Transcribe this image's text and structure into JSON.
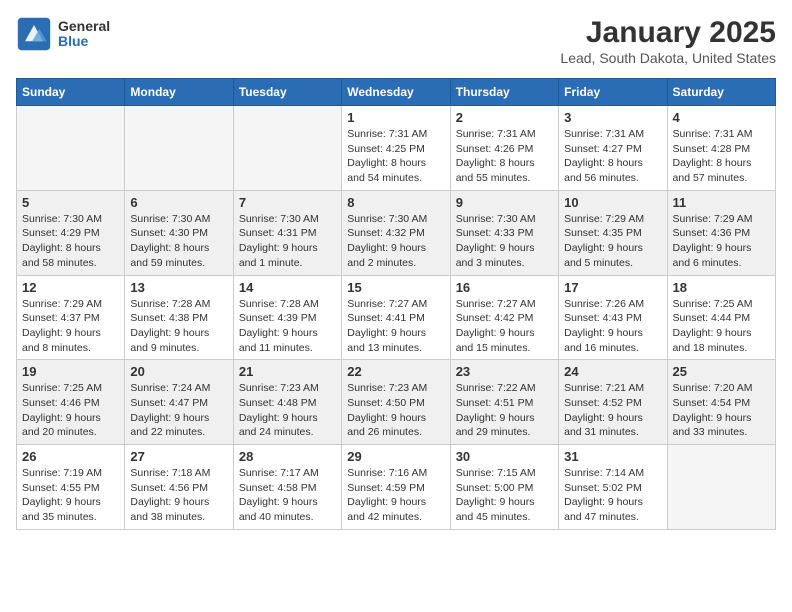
{
  "logo": {
    "general": "General",
    "blue": "Blue"
  },
  "title": {
    "month": "January 2025",
    "location": "Lead, South Dakota, United States"
  },
  "weekdays": [
    "Sunday",
    "Monday",
    "Tuesday",
    "Wednesday",
    "Thursday",
    "Friday",
    "Saturday"
  ],
  "weeks": [
    [
      {
        "day": "",
        "sunrise": "",
        "sunset": "",
        "daylight": ""
      },
      {
        "day": "",
        "sunrise": "",
        "sunset": "",
        "daylight": ""
      },
      {
        "day": "",
        "sunrise": "",
        "sunset": "",
        "daylight": ""
      },
      {
        "day": "1",
        "sunrise": "Sunrise: 7:31 AM",
        "sunset": "Sunset: 4:25 PM",
        "daylight": "Daylight: 8 hours and 54 minutes."
      },
      {
        "day": "2",
        "sunrise": "Sunrise: 7:31 AM",
        "sunset": "Sunset: 4:26 PM",
        "daylight": "Daylight: 8 hours and 55 minutes."
      },
      {
        "day": "3",
        "sunrise": "Sunrise: 7:31 AM",
        "sunset": "Sunset: 4:27 PM",
        "daylight": "Daylight: 8 hours and 56 minutes."
      },
      {
        "day": "4",
        "sunrise": "Sunrise: 7:31 AM",
        "sunset": "Sunset: 4:28 PM",
        "daylight": "Daylight: 8 hours and 57 minutes."
      }
    ],
    [
      {
        "day": "5",
        "sunrise": "Sunrise: 7:30 AM",
        "sunset": "Sunset: 4:29 PM",
        "daylight": "Daylight: 8 hours and 58 minutes."
      },
      {
        "day": "6",
        "sunrise": "Sunrise: 7:30 AM",
        "sunset": "Sunset: 4:30 PM",
        "daylight": "Daylight: 8 hours and 59 minutes."
      },
      {
        "day": "7",
        "sunrise": "Sunrise: 7:30 AM",
        "sunset": "Sunset: 4:31 PM",
        "daylight": "Daylight: 9 hours and 1 minute."
      },
      {
        "day": "8",
        "sunrise": "Sunrise: 7:30 AM",
        "sunset": "Sunset: 4:32 PM",
        "daylight": "Daylight: 9 hours and 2 minutes."
      },
      {
        "day": "9",
        "sunrise": "Sunrise: 7:30 AM",
        "sunset": "Sunset: 4:33 PM",
        "daylight": "Daylight: 9 hours and 3 minutes."
      },
      {
        "day": "10",
        "sunrise": "Sunrise: 7:29 AM",
        "sunset": "Sunset: 4:35 PM",
        "daylight": "Daylight: 9 hours and 5 minutes."
      },
      {
        "day": "11",
        "sunrise": "Sunrise: 7:29 AM",
        "sunset": "Sunset: 4:36 PM",
        "daylight": "Daylight: 9 hours and 6 minutes."
      }
    ],
    [
      {
        "day": "12",
        "sunrise": "Sunrise: 7:29 AM",
        "sunset": "Sunset: 4:37 PM",
        "daylight": "Daylight: 9 hours and 8 minutes."
      },
      {
        "day": "13",
        "sunrise": "Sunrise: 7:28 AM",
        "sunset": "Sunset: 4:38 PM",
        "daylight": "Daylight: 9 hours and 9 minutes."
      },
      {
        "day": "14",
        "sunrise": "Sunrise: 7:28 AM",
        "sunset": "Sunset: 4:39 PM",
        "daylight": "Daylight: 9 hours and 11 minutes."
      },
      {
        "day": "15",
        "sunrise": "Sunrise: 7:27 AM",
        "sunset": "Sunset: 4:41 PM",
        "daylight": "Daylight: 9 hours and 13 minutes."
      },
      {
        "day": "16",
        "sunrise": "Sunrise: 7:27 AM",
        "sunset": "Sunset: 4:42 PM",
        "daylight": "Daylight: 9 hours and 15 minutes."
      },
      {
        "day": "17",
        "sunrise": "Sunrise: 7:26 AM",
        "sunset": "Sunset: 4:43 PM",
        "daylight": "Daylight: 9 hours and 16 minutes."
      },
      {
        "day": "18",
        "sunrise": "Sunrise: 7:25 AM",
        "sunset": "Sunset: 4:44 PM",
        "daylight": "Daylight: 9 hours and 18 minutes."
      }
    ],
    [
      {
        "day": "19",
        "sunrise": "Sunrise: 7:25 AM",
        "sunset": "Sunset: 4:46 PM",
        "daylight": "Daylight: 9 hours and 20 minutes."
      },
      {
        "day": "20",
        "sunrise": "Sunrise: 7:24 AM",
        "sunset": "Sunset: 4:47 PM",
        "daylight": "Daylight: 9 hours and 22 minutes."
      },
      {
        "day": "21",
        "sunrise": "Sunrise: 7:23 AM",
        "sunset": "Sunset: 4:48 PM",
        "daylight": "Daylight: 9 hours and 24 minutes."
      },
      {
        "day": "22",
        "sunrise": "Sunrise: 7:23 AM",
        "sunset": "Sunset: 4:50 PM",
        "daylight": "Daylight: 9 hours and 26 minutes."
      },
      {
        "day": "23",
        "sunrise": "Sunrise: 7:22 AM",
        "sunset": "Sunset: 4:51 PM",
        "daylight": "Daylight: 9 hours and 29 minutes."
      },
      {
        "day": "24",
        "sunrise": "Sunrise: 7:21 AM",
        "sunset": "Sunset: 4:52 PM",
        "daylight": "Daylight: 9 hours and 31 minutes."
      },
      {
        "day": "25",
        "sunrise": "Sunrise: 7:20 AM",
        "sunset": "Sunset: 4:54 PM",
        "daylight": "Daylight: 9 hours and 33 minutes."
      }
    ],
    [
      {
        "day": "26",
        "sunrise": "Sunrise: 7:19 AM",
        "sunset": "Sunset: 4:55 PM",
        "daylight": "Daylight: 9 hours and 35 minutes."
      },
      {
        "day": "27",
        "sunrise": "Sunrise: 7:18 AM",
        "sunset": "Sunset: 4:56 PM",
        "daylight": "Daylight: 9 hours and 38 minutes."
      },
      {
        "day": "28",
        "sunrise": "Sunrise: 7:17 AM",
        "sunset": "Sunset: 4:58 PM",
        "daylight": "Daylight: 9 hours and 40 minutes."
      },
      {
        "day": "29",
        "sunrise": "Sunrise: 7:16 AM",
        "sunset": "Sunset: 4:59 PM",
        "daylight": "Daylight: 9 hours and 42 minutes."
      },
      {
        "day": "30",
        "sunrise": "Sunrise: 7:15 AM",
        "sunset": "Sunset: 5:00 PM",
        "daylight": "Daylight: 9 hours and 45 minutes."
      },
      {
        "day": "31",
        "sunrise": "Sunrise: 7:14 AM",
        "sunset": "Sunset: 5:02 PM",
        "daylight": "Daylight: 9 hours and 47 minutes."
      },
      {
        "day": "",
        "sunrise": "",
        "sunset": "",
        "daylight": ""
      }
    ]
  ]
}
